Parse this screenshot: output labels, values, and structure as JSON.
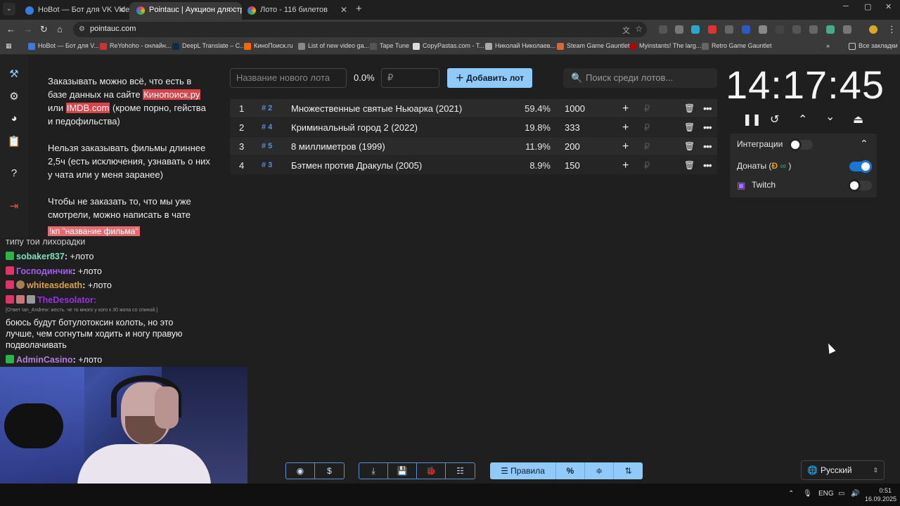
{
  "browser": {
    "tabs": [
      {
        "title": "HoBot — Бот для VK Video Live"
      },
      {
        "title": "Pointauc | Аукцион для стрим"
      },
      {
        "title": "Лото - 116 билетов"
      }
    ],
    "url": "pointauc.com",
    "bookmarks": [
      "HoBot — Бот для V...",
      "ReYohoho - онлайн...",
      "DeepL Translate – C...",
      "КиноПоиск.ru",
      "List of new video ga...",
      "Tape Tune",
      "CopyPastas.com - T...",
      "Николай Николаев...",
      "Steam Game Gauntlet",
      "Myinstants! The larg...",
      "Retro Game Gauntlet"
    ],
    "all_bookmarks": "Все закладки",
    "overflow": "»",
    "win_min": "─",
    "win_max": "▢",
    "win_close": "✕"
  },
  "rules": {
    "p1_a": "Заказывать можно всё, что есть в базе данных на сайте ",
    "p1_link1": "Кинопоиск.ру",
    "p1_b": " или ",
    "p1_link2": "IMDB.com",
    "p1_c": " (кроме порно, гейства и педофильства)",
    "p2": "Нельзя заказывать фильмы длиннее 2,5ч (есть исключения, узнавать о них у чата или у меня заранее)",
    "p3": "Чтобы не заказать то, что мы уже смотрели, можно написать в чате",
    "p3_cmd": "!кп \"название фильма\""
  },
  "chat": {
    "cut_line": "типу той лихорадки",
    "msgs": [
      {
        "user": "sobaker837",
        "text": "+лото",
        "color": "#7ee0c0",
        "badge": "#2cb34a"
      },
      {
        "user": "Господинчик",
        "text": "+лото",
        "color": "#a35cf0",
        "badge": "#e0336a"
      },
      {
        "user": "whiteasdeath",
        "text": "+лото",
        "color": "#e0a040",
        "badge": "#e0336a"
      },
      {
        "user": "TheDesolator",
        "text": "",
        "color": "#9b30e0",
        "badge": "#e0336a"
      }
    ],
    "reply": "[Ответ Ian_Andrew: жесть. че то много у кого к 30 жопа со спиной.]",
    "long_msg": "боюсь будут ботулотоксин колоть, но это лучше, чем согнутым ходить и ногу правую подволачивать",
    "last": {
      "user": "AdminCasino",
      "text": "+лото",
      "color": "#b07ee0",
      "badge": "#2cb34a"
    }
  },
  "controls": {
    "new_lot_placeholder": "Название нового лота",
    "percent": "0.0%",
    "amount_placeholder": "₽",
    "add_button": "Добавить лот",
    "search_placeholder": "Поиск среди лотов..."
  },
  "lots": [
    {
      "idx": "1",
      "id": "# 2",
      "name": "Множественные святые Ньюарка (2021)",
      "pct": "59.4%",
      "amount": "1000"
    },
    {
      "idx": "2",
      "id": "# 4",
      "name": "Криминальный город 2 (2022)",
      "pct": "19.8%",
      "amount": "333"
    },
    {
      "idx": "3",
      "id": "# 5",
      "name": "8 миллиметров (1999)",
      "pct": "11.9%",
      "amount": "200"
    },
    {
      "idx": "4",
      "id": "# 3",
      "name": "Бэтмен против Дракулы (2005)",
      "pct": "8.9%",
      "amount": "150"
    }
  ],
  "lot_row": {
    "rub": "₽",
    "plus": "+",
    "delete": "🗑",
    "more": "•••"
  },
  "timer": {
    "time": "14:17:45"
  },
  "integrations": {
    "title": "Интеграции",
    "donations": "Донаты (",
    "donations_close": ")",
    "twitch": "Twitch",
    "donations_on": true,
    "twitch_on": false,
    "master_on": false
  },
  "bottom": {
    "rules_button": "Правила",
    "percent_button": "%",
    "language": "Русский"
  },
  "taskbar": {
    "lang": "ENG",
    "time": "0:51",
    "date": "16.09.2025"
  }
}
